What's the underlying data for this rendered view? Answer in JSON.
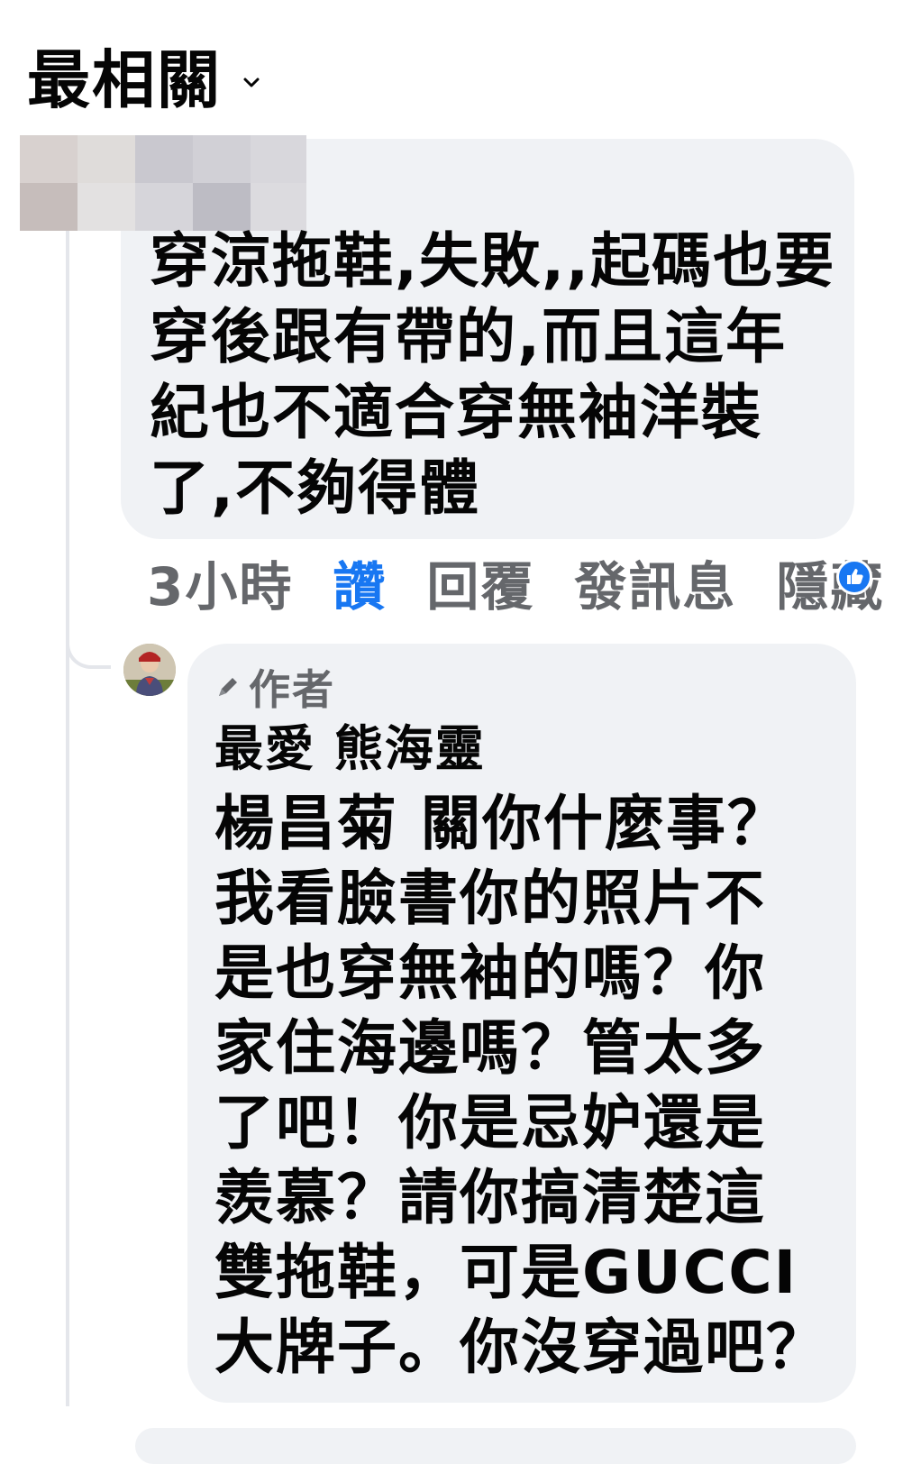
{
  "sort": {
    "label": "最相關"
  },
  "comment": {
    "text": "穿涼拖鞋,失敗,,起碼也要\n穿後跟有帶的,而且這年\n紀也不適合穿無袖洋裝\n了,不夠得體",
    "time": "3小時",
    "actions": {
      "like": "讚",
      "reply": "回覆",
      "message": "發訊息",
      "hide": "隱藏"
    }
  },
  "reply": {
    "badge": "作者",
    "author": "最愛 熊海靈",
    "text": "楊昌菊 關你什麼事？\n我看臉書你的照片不\n是也穿無袖的嗎？你\n家住海邊嗎？管太多\n了吧！你是忌妒還是\n羨慕？請你搞清楚這\n雙拖鞋，可是GUCCI\n大牌子。你沒穿過吧？"
  },
  "colors": {
    "bubble": "#f0f2f5",
    "meta_gray": "#65676b",
    "link_blue": "#1877f2",
    "text": "#050505"
  },
  "icons": {
    "sort": "chevron-down-icon",
    "like_reaction": "thumbs-up-icon",
    "author_badge": "pencil-icon"
  }
}
